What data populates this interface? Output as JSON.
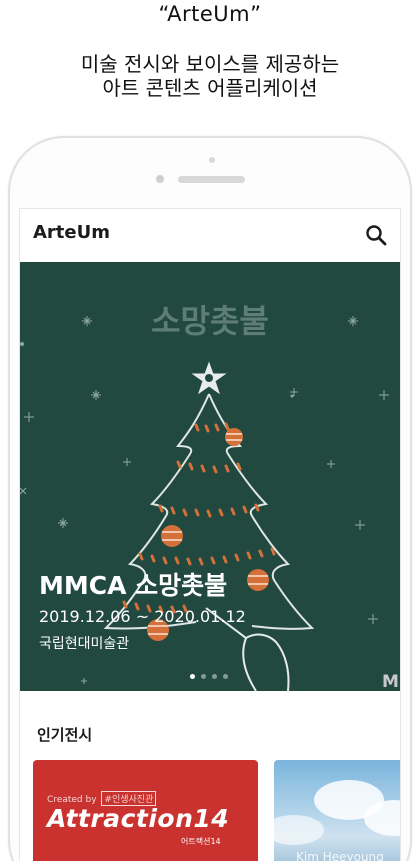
{
  "promo": {
    "title": "“ArteUm”",
    "subtitle_line1": "미술 전시와 보이스를 제공하는",
    "subtitle_line2": "아트 콘텐츠 어플리케이션"
  },
  "app": {
    "title": "ArteUm",
    "search_icon": "search-icon"
  },
  "banner": {
    "poster_title": "소망촛불",
    "exhibition_title": "MMCA 소망촛불",
    "dates": "2019.12.06 ~ 2020.01.12",
    "venue": "국립현대미술관",
    "corner_mark": "M",
    "slide_count": 4,
    "active_slide": 1
  },
  "popular": {
    "title": "인기전시",
    "cards": [
      {
        "credit_prefix": "Created by",
        "credit_tag": "#인생사진관",
        "title": "Attraction14",
        "subtitle": "어트랙션14"
      },
      {
        "artist": "Kim Heeyoung"
      }
    ]
  },
  "colors": {
    "banner_bg": "#224940",
    "card_red": "#c9322f",
    "ornament": "#d4703a"
  }
}
